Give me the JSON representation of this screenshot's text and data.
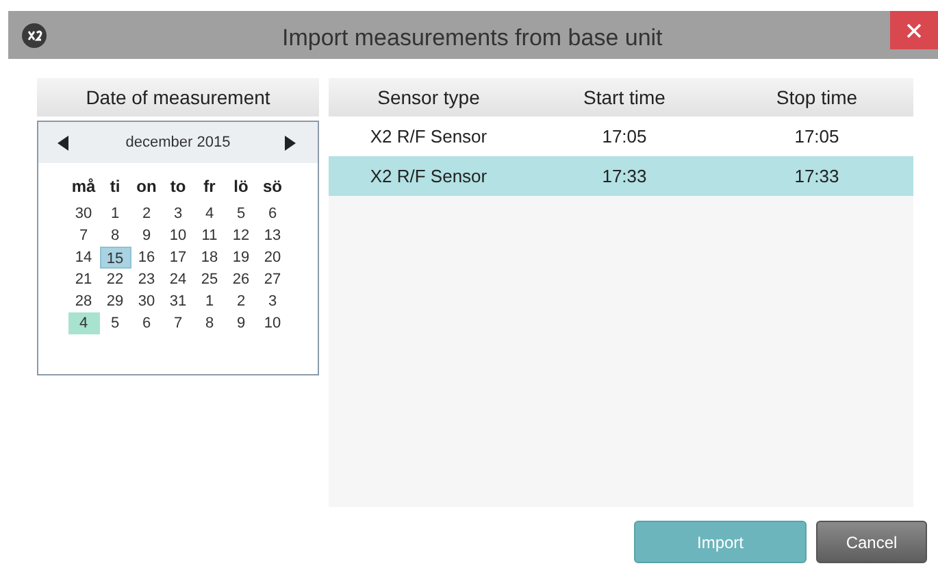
{
  "window": {
    "title": "Import measurements from base unit"
  },
  "calendar": {
    "header": "Date of measurement",
    "month": "december 2015",
    "weekdays": [
      "må",
      "ti",
      "on",
      "to",
      "fr",
      "lö",
      "sö"
    ],
    "weeks": [
      [
        {
          "day": "30",
          "selected": false,
          "today": false
        },
        {
          "day": "1",
          "selected": false,
          "today": false
        },
        {
          "day": "2",
          "selected": false,
          "today": false
        },
        {
          "day": "3",
          "selected": false,
          "today": false
        },
        {
          "day": "4",
          "selected": false,
          "today": false
        },
        {
          "day": "5",
          "selected": false,
          "today": false
        },
        {
          "day": "6",
          "selected": false,
          "today": false
        }
      ],
      [
        {
          "day": "7",
          "selected": false,
          "today": false
        },
        {
          "day": "8",
          "selected": false,
          "today": false
        },
        {
          "day": "9",
          "selected": false,
          "today": false
        },
        {
          "day": "10",
          "selected": false,
          "today": false
        },
        {
          "day": "11",
          "selected": false,
          "today": false
        },
        {
          "day": "12",
          "selected": false,
          "today": false
        },
        {
          "day": "13",
          "selected": false,
          "today": false
        }
      ],
      [
        {
          "day": "14",
          "selected": false,
          "today": false
        },
        {
          "day": "15",
          "selected": true,
          "today": false
        },
        {
          "day": "16",
          "selected": false,
          "today": false
        },
        {
          "day": "17",
          "selected": false,
          "today": false
        },
        {
          "day": "18",
          "selected": false,
          "today": false
        },
        {
          "day": "19",
          "selected": false,
          "today": false
        },
        {
          "day": "20",
          "selected": false,
          "today": false
        }
      ],
      [
        {
          "day": "21",
          "selected": false,
          "today": false
        },
        {
          "day": "22",
          "selected": false,
          "today": false
        },
        {
          "day": "23",
          "selected": false,
          "today": false
        },
        {
          "day": "24",
          "selected": false,
          "today": false
        },
        {
          "day": "25",
          "selected": false,
          "today": false
        },
        {
          "day": "26",
          "selected": false,
          "today": false
        },
        {
          "day": "27",
          "selected": false,
          "today": false
        }
      ],
      [
        {
          "day": "28",
          "selected": false,
          "today": false
        },
        {
          "day": "29",
          "selected": false,
          "today": false
        },
        {
          "day": "30",
          "selected": false,
          "today": false
        },
        {
          "day": "31",
          "selected": false,
          "today": false
        },
        {
          "day": "1",
          "selected": false,
          "today": false
        },
        {
          "day": "2",
          "selected": false,
          "today": false
        },
        {
          "day": "3",
          "selected": false,
          "today": false
        }
      ],
      [
        {
          "day": "4",
          "selected": false,
          "today": true
        },
        {
          "day": "5",
          "selected": false,
          "today": false
        },
        {
          "day": "6",
          "selected": false,
          "today": false
        },
        {
          "day": "7",
          "selected": false,
          "today": false
        },
        {
          "day": "8",
          "selected": false,
          "today": false
        },
        {
          "day": "9",
          "selected": false,
          "today": false
        },
        {
          "day": "10",
          "selected": false,
          "today": false
        }
      ]
    ]
  },
  "table": {
    "columns": [
      "Sensor type",
      "Start time",
      "Stop time"
    ],
    "rows": [
      {
        "cells": [
          "X2 R/F Sensor",
          "17:05",
          "17:05"
        ],
        "selected": false
      },
      {
        "cells": [
          "X2 R/F Sensor",
          "17:33",
          "17:33"
        ],
        "selected": true
      }
    ]
  },
  "buttons": [
    {
      "label": "Import",
      "kind": "primary"
    },
    {
      "label": "Cancel",
      "kind": "secondary"
    }
  ]
}
